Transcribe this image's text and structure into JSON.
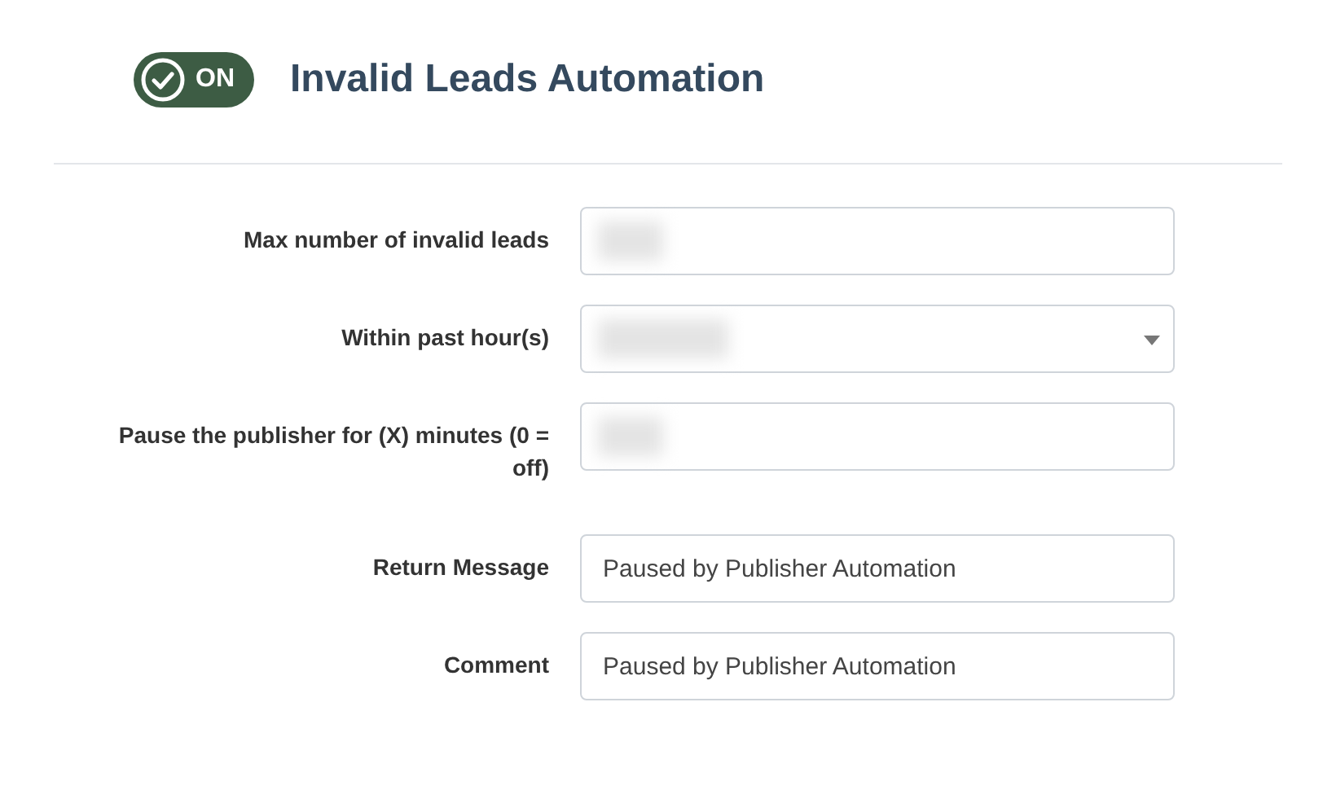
{
  "header": {
    "toggle": {
      "label": "ON",
      "on": true
    },
    "title": "Invalid Leads Automation"
  },
  "fields": [
    {
      "label": "Max number of invalid leads",
      "kind": "text",
      "redacted": true
    },
    {
      "label": "Within past hour(s)",
      "kind": "select",
      "redacted": true
    },
    {
      "label": "Pause the publisher for (X) minutes (0 = off)",
      "kind": "text",
      "redacted": true
    },
    {
      "label": "Return Message",
      "kind": "text",
      "value": "Paused by Publisher Automation"
    },
    {
      "label": "Comment",
      "kind": "text",
      "value": "Paused by Publisher Automation"
    }
  ]
}
